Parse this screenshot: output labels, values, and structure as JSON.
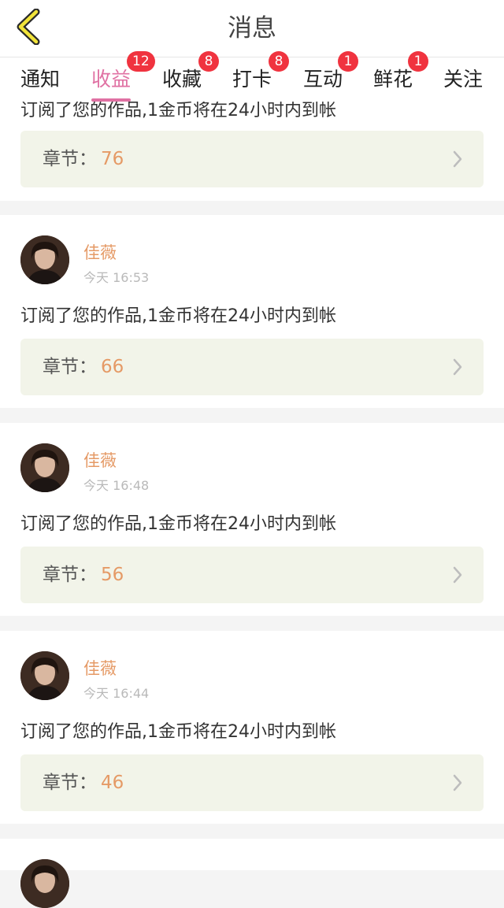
{
  "header": {
    "title": "消息"
  },
  "tabs": [
    {
      "label": "通知",
      "badge": ""
    },
    {
      "label": "收益",
      "badge": "12",
      "active": true
    },
    {
      "label": "收藏",
      "badge": "8"
    },
    {
      "label": "打卡",
      "badge": "8"
    },
    {
      "label": "互动",
      "badge": "1"
    },
    {
      "label": "鲜花",
      "badge": "1"
    },
    {
      "label": "关注",
      "badge": ""
    }
  ],
  "partial_card": {
    "message": "订阅了您的作品,1金币将在24小时内到帐",
    "chapter_label": "章节：",
    "chapter_value": "76"
  },
  "items": [
    {
      "name": "佳薇",
      "time": "今天 16:53",
      "message": "订阅了您的作品,1金币将在24小时内到帐",
      "chapter_label": "章节：",
      "chapter_value": "66"
    },
    {
      "name": "佳薇",
      "time": "今天 16:48",
      "message": "订阅了您的作品,1金币将在24小时内到帐",
      "chapter_label": "章节：",
      "chapter_value": "56"
    },
    {
      "name": "佳薇",
      "time": "今天 16:44",
      "message": "订阅了您的作品,1金币将在24小时内到帐",
      "chapter_label": "章节：",
      "chapter_value": "46"
    }
  ],
  "colors": {
    "accent": "#e071a3",
    "badge": "#f0333f",
    "name": "#e59a66",
    "chapter_bg": "#f2f4e9"
  },
  "icons": {
    "back": "chevron-left-icon",
    "row_arrow": "chevron-right-icon",
    "avatar": "user-avatar"
  }
}
